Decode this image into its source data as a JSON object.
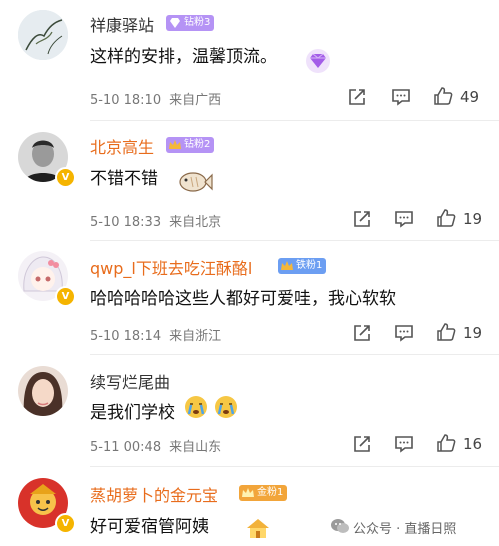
{
  "comments": [
    {
      "username": "祥康驿站",
      "badge": "钻粉3",
      "text": "这样的安排，温馨顶流。",
      "time": "5-10 18:10",
      "location": "来自广西",
      "likes": "49",
      "badge_color": "#b593f5"
    },
    {
      "username": "北京高生",
      "badge": "钻粉2",
      "text": "不错不错",
      "time": "5-10 18:33",
      "location": "来自北京",
      "likes": "19",
      "badge_color": "#b593f5"
    },
    {
      "username": "qwp_l下班去吃汪酥酪l",
      "badge": "铁粉1",
      "text": "哈哈哈哈哈这些人都好可爱哇，我心软软",
      "time": "5-10 18:14",
      "location": "来自浙江",
      "likes": "19",
      "badge_color": "#6c9ef2"
    },
    {
      "username": "续写烂尾曲",
      "text": "是我们学校",
      "time": "5-11 00:48",
      "location": "来自山东",
      "likes": "16"
    },
    {
      "username": "蒸胡萝卜的金元宝",
      "badge": "金粉1",
      "text": "好可爱宿管阿姨"
    }
  ],
  "watermark": "公众号 · 直播日照",
  "colors": {
    "orange_name": "#e86c1c",
    "meta_gray": "#777777",
    "icon_gray": "#555555"
  }
}
